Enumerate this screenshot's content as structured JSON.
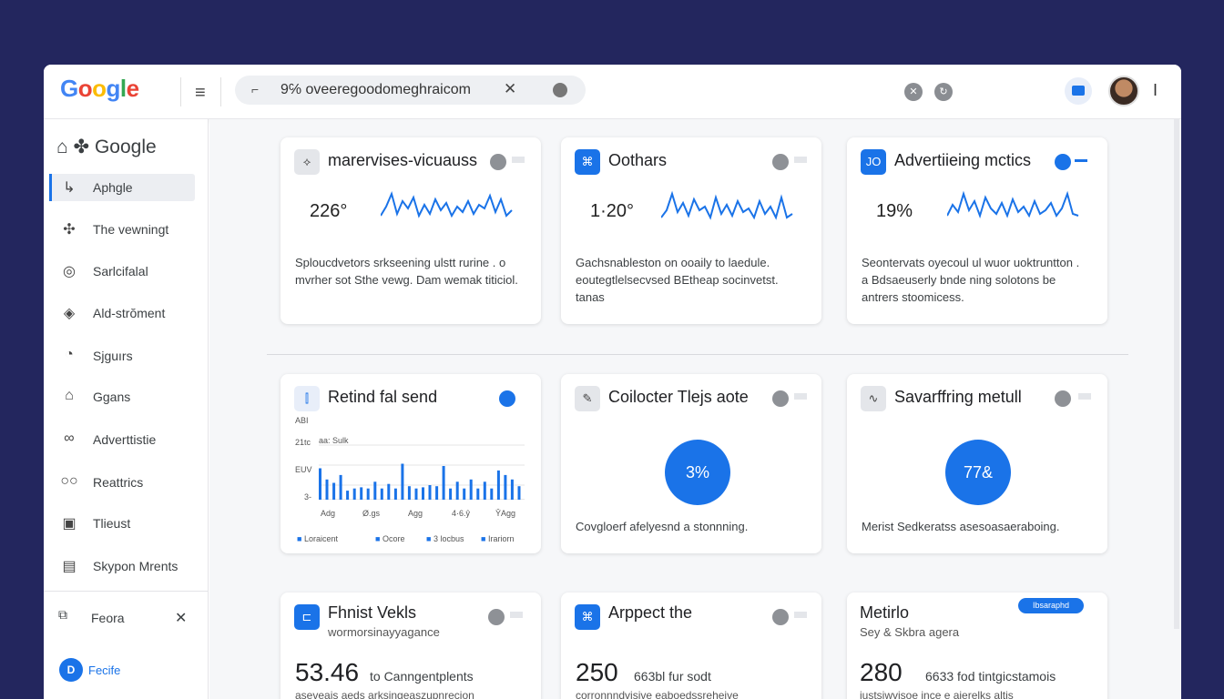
{
  "colors": {
    "accent": "#1a73e8",
    "background": "#23265e",
    "chart_bar": "#1a73e8"
  },
  "header": {
    "logo": [
      "G",
      "o",
      "o",
      "g",
      "l",
      "e"
    ],
    "url": "9℅ oveeregoodomeghraicom",
    "url_icon": "tab-icon",
    "hamburger": "menu-icon",
    "cursor": "I"
  },
  "sidebar": {
    "title": "Google",
    "items": [
      {
        "label": "Aphgle",
        "icon": "pointer-icon",
        "glyph": "↳"
      },
      {
        "label": "The vewningt",
        "icon": "spark-icon",
        "glyph": "✣"
      },
      {
        "label": "Sarlcifalal",
        "icon": "target-icon",
        "glyph": "◎"
      },
      {
        "label": "Ald-strŏment",
        "icon": "compass-icon",
        "glyph": "◈"
      },
      {
        "label": "Sjguırs",
        "icon": "bulb-icon",
        "glyph": "◔"
      },
      {
        "label": "Ggans",
        "icon": "car-icon",
        "glyph": "⌂"
      },
      {
        "label": "Adverttistie",
        "icon": "link-icon",
        "glyph": "∞"
      },
      {
        "label": "Reattrics",
        "icon": "glasses-icon",
        "glyph": "○○"
      },
      {
        "label": "Tlieust",
        "icon": "doc-icon",
        "glyph": "▣"
      },
      {
        "label": "Skypon Mrents",
        "icon": "calendar-icon",
        "glyph": "▤"
      }
    ],
    "footer_label": "Feora",
    "user_initials": "D",
    "user_label": "Fecife"
  },
  "cards_top": [
    {
      "title": "marervises-vicuauss",
      "metric": "226°",
      "description": "Sploucdvetors srkseening ulstt rurine . o mvrher sot Sthe vewg. Dam wemak titiciol."
    },
    {
      "title": "Oothars",
      "metric": "1·20°",
      "description": "Gachsnableston on ooaily to laedule. eoutegtlelsecvsed BEtheap socinvetst. tanas"
    },
    {
      "title": "Advertiieing mctics",
      "metric": "19%",
      "description": "Seontervats oyecoul ul wuor uoktruntton . a Bdsaeuserly bnde ning solotons be antrers stoomicess."
    }
  ],
  "card_chart": {
    "title": "Retind fal send",
    "y_tick_labels": [
      "ABI",
      "21tc",
      "EUV",
      "3-"
    ],
    "annotation": "aa: Sulk",
    "x_tick_labels": [
      "Adg",
      "Ø.gs",
      "Agg",
      "4·6.ŷ",
      "ŶAgg"
    ],
    "legend": [
      "Loraicent",
      "Ocore",
      "3 locbus",
      "Irariorn"
    ]
  },
  "card_donut_1": {
    "title": "Coilocter Tlejs aote",
    "value": "3%",
    "description": "Covgloerf afelyesnd a stonnning."
  },
  "card_donut_2": {
    "title": "Savarffring metull",
    "value": "77&",
    "description": "Merist Sedkeratss asesoasaeraboing."
  },
  "cards_bottom": [
    {
      "title": "Fhnist Vekls",
      "sub": "wormorsinayyagance",
      "number": "53.46",
      "caption": "to Canngentplents",
      "foot": "aseveais aeds arksingeaszupnrecion"
    },
    {
      "title": "Arppect the",
      "sub": "",
      "number": "250",
      "caption": "663bl fur sodt",
      "foot": "corronnndvisive eaboedssreheive"
    },
    {
      "title": "Metirlo",
      "sub": "Sey & Skbra agera",
      "number": "280",
      "caption": "6633 fod tintgicstamois",
      "foot": "iustsiwvisoe ince e aierelks altis",
      "pill": "Ibsaraphd"
    }
  ],
  "chart_data": {
    "type": "bar",
    "title": "Retind fal send",
    "series": [
      {
        "values": [
          28,
          12,
          18,
          10,
          15,
          20,
          22,
          14,
          8,
          12,
          10,
          16,
          11,
          8,
          10,
          18,
          16,
          8,
          10,
          40,
          14,
          16,
          10,
          12,
          32,
          8,
          12,
          14,
          10,
          8,
          11,
          40,
          13,
          18,
          12,
          10,
          30,
          12,
          10,
          50,
          16,
          22,
          10,
          14,
          18,
          12,
          10,
          8,
          16,
          12,
          10,
          20,
          26,
          18,
          22,
          12,
          18,
          14,
          12,
          30
        ]
      }
    ],
    "ylim": [
      0,
      60
    ],
    "grid": true
  }
}
